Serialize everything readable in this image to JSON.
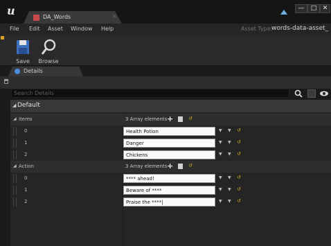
{
  "window": {
    "logo": "u",
    "tab_title": "DA_Words",
    "tab_close": "×",
    "minimize": "—",
    "maximize": "□",
    "close": "✕"
  },
  "menu": {
    "items": [
      "File",
      "Edit",
      "Asset",
      "Window",
      "Help"
    ],
    "asset_type_label": "Asset Type:",
    "asset_type_value": "words-data-asset_"
  },
  "toolbar": {
    "save_label": "Save",
    "browse_label": "Browse"
  },
  "details_tab": {
    "label": "Details"
  },
  "search": {
    "placeholder": "Search Details"
  },
  "category": {
    "label": "Default",
    "arrow": "◢"
  },
  "items_array": {
    "label": "Items",
    "count_text": "3 Array elements",
    "elements": [
      {
        "index": "0",
        "value": "Health Potion"
      },
      {
        "index": "1",
        "value": "Danger"
      },
      {
        "index": "2",
        "value": "Chickens"
      }
    ]
  },
  "action_array": {
    "label": "Action",
    "count_text": "3 Array elements",
    "elements": [
      {
        "index": "0",
        "value": "**** ahead!"
      },
      {
        "index": "1",
        "value": "Beware of ****"
      },
      {
        "index": "2",
        "value": "Praise the ****|"
      }
    ]
  },
  "controls": {
    "add": "+",
    "reset": "↺",
    "dropdown": "▼",
    "expand_arrow": "◢"
  },
  "colors": {
    "accent_yellow": "#d8b020",
    "tab_icon_red": "#c84a4a",
    "details_icon_blue": "#4a8cd8"
  }
}
